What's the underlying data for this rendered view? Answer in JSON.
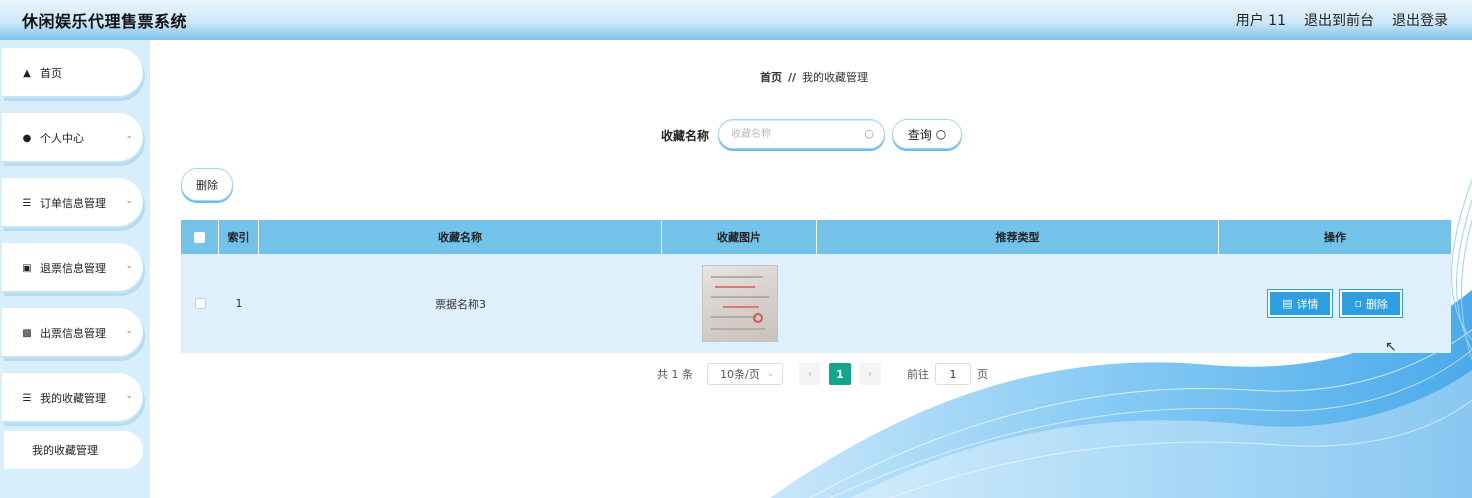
{
  "header": {
    "title": "休闲娱乐代理售票系统",
    "user": "用户 11",
    "back_front": "退出到前台",
    "logout": "退出登录"
  },
  "sidebar": {
    "items": [
      {
        "label": "首页",
        "icon": "home-icon"
      },
      {
        "label": "个人中心",
        "icon": "user-icon"
      },
      {
        "label": "订单信息管理",
        "icon": "list-icon"
      },
      {
        "label": "退票信息管理",
        "icon": "ticket-icon"
      },
      {
        "label": "出票信息管理",
        "icon": "chart-icon"
      },
      {
        "label": "我的收藏管理",
        "icon": "menu-icon"
      }
    ],
    "submenu": "我的收藏管理"
  },
  "breadcrumb": {
    "home": "首页",
    "sep": "//",
    "current": "我的收藏管理"
  },
  "search": {
    "label": "收藏名称",
    "placeholder": "收藏名称",
    "button": "查询"
  },
  "toolbar": {
    "delete": "删除"
  },
  "table": {
    "columns": [
      "索引",
      "收藏名称",
      "收藏图片",
      "推荐类型",
      "操作"
    ],
    "rows": [
      {
        "index": "1",
        "name": "票据名称3",
        "type": "",
        "detail": "详情",
        "delete": "删除"
      }
    ]
  },
  "pagination": {
    "total": "共 1 条",
    "page_size": "10条/页",
    "current_page": "1",
    "goto_label": "前往",
    "goto_value": "1",
    "page_unit": "页"
  },
  "colors": {
    "header_gradient_end": "#7cc3ec",
    "table_header": "#72c2ea",
    "table_row": "#ddf0fb",
    "button_blue": "#2c9fe2",
    "page_active": "#11a68e"
  }
}
